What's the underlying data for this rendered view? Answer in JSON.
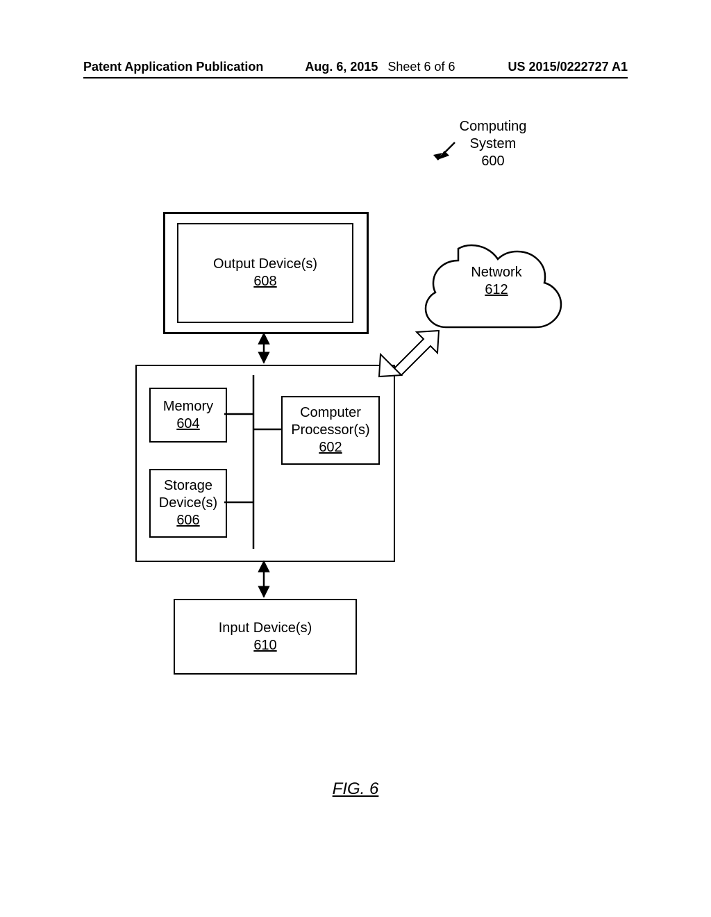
{
  "header": {
    "publication": "Patent Application Publication",
    "date": "Aug. 6, 2015",
    "sheet": "Sheet 6 of 6",
    "docnum": "US 2015/0222727 A1"
  },
  "title_label": {
    "line1": "Computing",
    "line2": "System",
    "ref": "600"
  },
  "output_device": {
    "label": "Output Device(s)",
    "ref": "608"
  },
  "memory": {
    "label": "Memory",
    "ref": "604"
  },
  "processor": {
    "line1": "Computer",
    "line2": "Processor(s)",
    "ref": "602"
  },
  "storage": {
    "line1": "Storage",
    "line2": "Device(s)",
    "ref": "606"
  },
  "input_device": {
    "label": "Input Device(s)",
    "ref": "610"
  },
  "network": {
    "label": "Network",
    "ref": "612"
  },
  "figure_caption": "FIG. 6"
}
